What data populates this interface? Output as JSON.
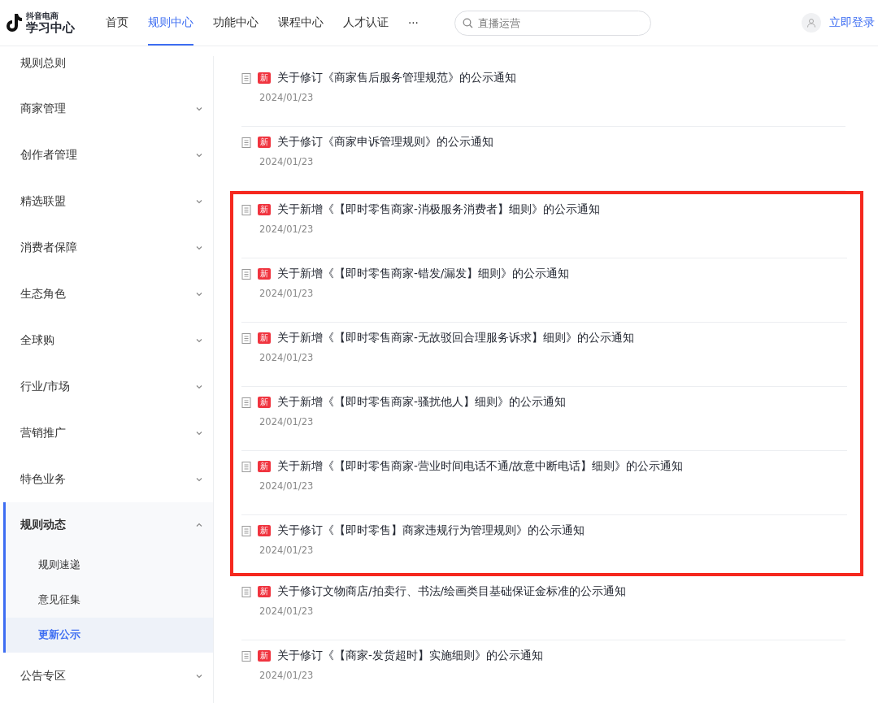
{
  "header": {
    "logo_small": "抖音电商",
    "logo_title": "学习中心",
    "nav": [
      {
        "label": "首页",
        "selected": false
      },
      {
        "label": "规则中心",
        "selected": true
      },
      {
        "label": "功能中心",
        "selected": false
      },
      {
        "label": "课程中心",
        "selected": false
      },
      {
        "label": "人才认证",
        "selected": false
      },
      {
        "label": "···",
        "selected": false
      }
    ],
    "search": {
      "placeholder": "直播运营"
    },
    "login": "立即登录"
  },
  "sidebar": {
    "items": [
      {
        "label": "规则总则"
      },
      {
        "label": "商家管理",
        "expanded": false
      },
      {
        "label": "创作者管理",
        "expanded": false
      },
      {
        "label": "精选联盟",
        "expanded": false
      },
      {
        "label": "消费者保障",
        "expanded": false
      },
      {
        "label": "生态角色",
        "expanded": false
      },
      {
        "label": "全球购",
        "expanded": false
      },
      {
        "label": "行业/市场",
        "expanded": false
      },
      {
        "label": "营销推广",
        "expanded": false
      },
      {
        "label": "特色业务",
        "expanded": false
      },
      {
        "label": "规则动态",
        "expanded": true,
        "children": [
          {
            "label": "规则速递",
            "selected": false
          },
          {
            "label": "意见征集",
            "selected": false
          },
          {
            "label": "更新公示",
            "selected": true
          }
        ]
      },
      {
        "label": "公告专区",
        "expanded": false
      }
    ]
  },
  "notices": [
    {
      "badge": "新",
      "title": "关于修订《商家售后服务管理规范》的公示通知",
      "date": "2024/01/23",
      "highlighted": false
    },
    {
      "badge": "新",
      "title": "关于修订《商家申诉管理规则》的公示通知",
      "date": "2024/01/23",
      "highlighted": false
    },
    {
      "badge": "新",
      "title": "关于新增《【即时零售商家-消极服务消费者】细则》的公示通知",
      "date": "2024/01/23",
      "highlighted": true
    },
    {
      "badge": "新",
      "title": "关于新增《【即时零售商家-错发/漏发】细则》的公示通知",
      "date": "2024/01/23",
      "highlighted": true
    },
    {
      "badge": "新",
      "title": "关于新增《【即时零售商家-无故驳回合理服务诉求】细则》的公示通知",
      "date": "2024/01/23",
      "highlighted": true
    },
    {
      "badge": "新",
      "title": "关于新增《【即时零售商家-骚扰他人】细则》的公示通知",
      "date": "2024/01/23",
      "highlighted": true
    },
    {
      "badge": "新",
      "title": "关于新增《【即时零售商家-营业时间电话不通/故意中断电话】细则》的公示通知",
      "date": "2024/01/23",
      "highlighted": true
    },
    {
      "badge": "新",
      "title": "关于修订《【即时零售】商家违规行为管理规则》的公示通知",
      "date": "2024/01/23",
      "highlighted": true
    },
    {
      "badge": "新",
      "title": "关于修订文物商店/拍卖行、书法/绘画类目基础保证金标准的公示通知",
      "date": "2024/01/23",
      "highlighted": false
    },
    {
      "badge": "新",
      "title": "关于修订《【商家-发货超时】实施细则》的公示通知",
      "date": "2024/01/23",
      "highlighted": false
    }
  ]
}
